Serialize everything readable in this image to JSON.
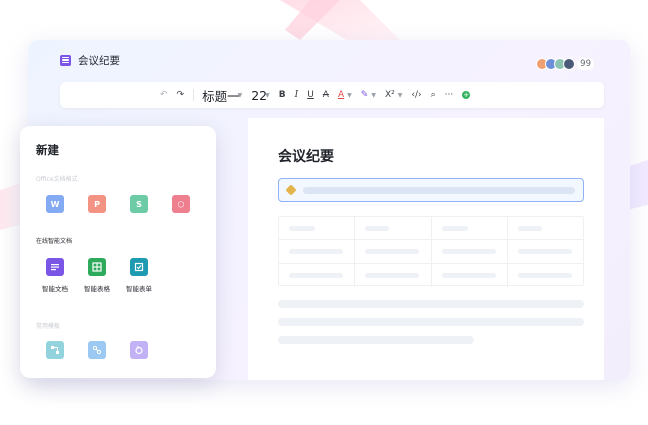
{
  "colors": {
    "accent": "#7b55e6",
    "word": "#5b8ef0",
    "ppt": "#f0705a",
    "sheet": "#3dbb88",
    "pdf": "#e8556a",
    "smart_doc": "#7b55e6",
    "smart_sheet": "#2eaa5c",
    "smart_form": "#1e9bb0"
  },
  "window": {
    "title": "会议纪要",
    "title_icon": "doc-icon",
    "collaborators_count": "99"
  },
  "toolbar": {
    "undo_icon": "undo-icon",
    "redo_icon": "redo-icon",
    "heading_label": "标题一",
    "font_size": "22",
    "bold": "B",
    "italic": "I",
    "underline": "U",
    "strike": "A",
    "font_color": "A",
    "highlight_icon": "highlight-icon",
    "superscript": "X²",
    "code": "‹/›",
    "search_icon": "search-icon",
    "more": "···",
    "add_icon": "add-icon"
  },
  "document": {
    "heading": "会议纪要"
  },
  "new_panel": {
    "title": "新建",
    "section_office": "Office文档格式",
    "office_items": [
      {
        "letter": "W",
        "icon": "word-icon"
      },
      {
        "letter": "P",
        "icon": "ppt-icon"
      },
      {
        "letter": "S",
        "icon": "sheet-icon"
      },
      {
        "letter": "⬡",
        "icon": "pdf-icon"
      }
    ],
    "section_smart": "在线智能文档",
    "smart_items": [
      {
        "label": "智能文档",
        "icon": "smart-doc-icon"
      },
      {
        "label": "智能表格",
        "icon": "smart-sheet-icon"
      },
      {
        "label": "智能表单",
        "icon": "smart-form-icon"
      }
    ],
    "section_common": "常用模板",
    "template_items": [
      {
        "icon": "template-flow-icon"
      },
      {
        "icon": "template-mindmap-icon"
      },
      {
        "icon": "template-cycle-icon"
      }
    ]
  }
}
